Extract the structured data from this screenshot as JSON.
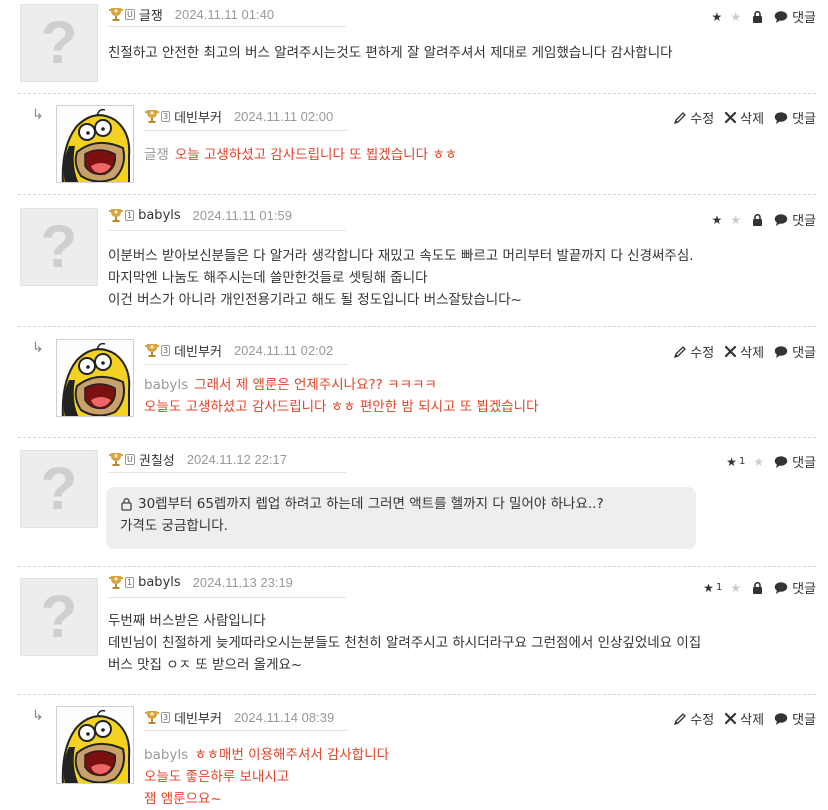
{
  "actions": {
    "edit": "수정",
    "delete": "삭제",
    "reply": "댓글"
  },
  "colors": {
    "reply_red": "#e0442a",
    "muted": "#999999",
    "secret_bg": "#eeeeee"
  },
  "comments": [
    {
      "author": "글쟁",
      "level": "U",
      "date": "2024.11.11 01:40",
      "lines": [
        "친절하고 안전한 최고의 버스 알려주시는것도 편하게 잘 알려주셔서 제대로 게임했습니다 감사합니다"
      ]
    },
    {
      "author": "데빈부커",
      "level": "3",
      "date": "2024.11.11 02:00",
      "reply_to": "글쟁",
      "lines": [
        "오늘 고생하셨고 감사드립니다 또 뵙겠습니다 ㅎㅎ"
      ]
    },
    {
      "author": "babyls",
      "level": "1",
      "date": "2024.11.11 01:59",
      "lines": [
        "이분버스 받아보신분들은 다 알거라 생각합니다 재밌고 속도도 빠르고 머리부터 발끝까지 다 신경써주심.",
        "마지막엔 나눔도 해주시는데 쓸만한것들로 셋팅해 줍니다",
        "이건 버스가 아니라 개인전용기라고 해도 될 정도입니다 버스잘탔습니다~"
      ]
    },
    {
      "author": "데빈부커",
      "level": "3",
      "date": "2024.11.11 02:02",
      "reply_to": "babyls",
      "lines": [
        "그래서 제 앰룬은 언제주시나요?? ㅋㅋㅋㅋ",
        "오늘도 고생하셨고 감사드립니다 ㅎㅎ 편안한 밤 되시고 또 뵙겠습니다"
      ]
    },
    {
      "author": "권칠성",
      "level": "U",
      "date": "2024.11.12 22:17",
      "star_count": "1",
      "lines": [
        "30렙부터 65렙까지 렙업 하려고 하는데 그러면 액트를 헬까지 다 밀어야 하나요..?",
        "가격도 궁금합니다."
      ]
    },
    {
      "author": "babyls",
      "level": "1",
      "date": "2024.11.13 23:19",
      "star_count": "1",
      "lines": [
        "두번째 버스받은 사람입니다",
        "데빈님이 친절하게 늦게따라오시는분들도 천천히 알려주시고 하시더라구요 그런점에서 인상깊었네요 이집",
        "버스 맛집 ㅇㅈ 또 받으러 올게요~"
      ]
    },
    {
      "author": "데빈부커",
      "level": "3",
      "date": "2024.11.14 08:39",
      "reply_to": "babyls",
      "lines": [
        "ㅎㅎ매번 이용해주셔서 감사합니다",
        "오늘도 좋은하루 보내시고",
        "잼 앰룬으요~"
      ]
    }
  ]
}
